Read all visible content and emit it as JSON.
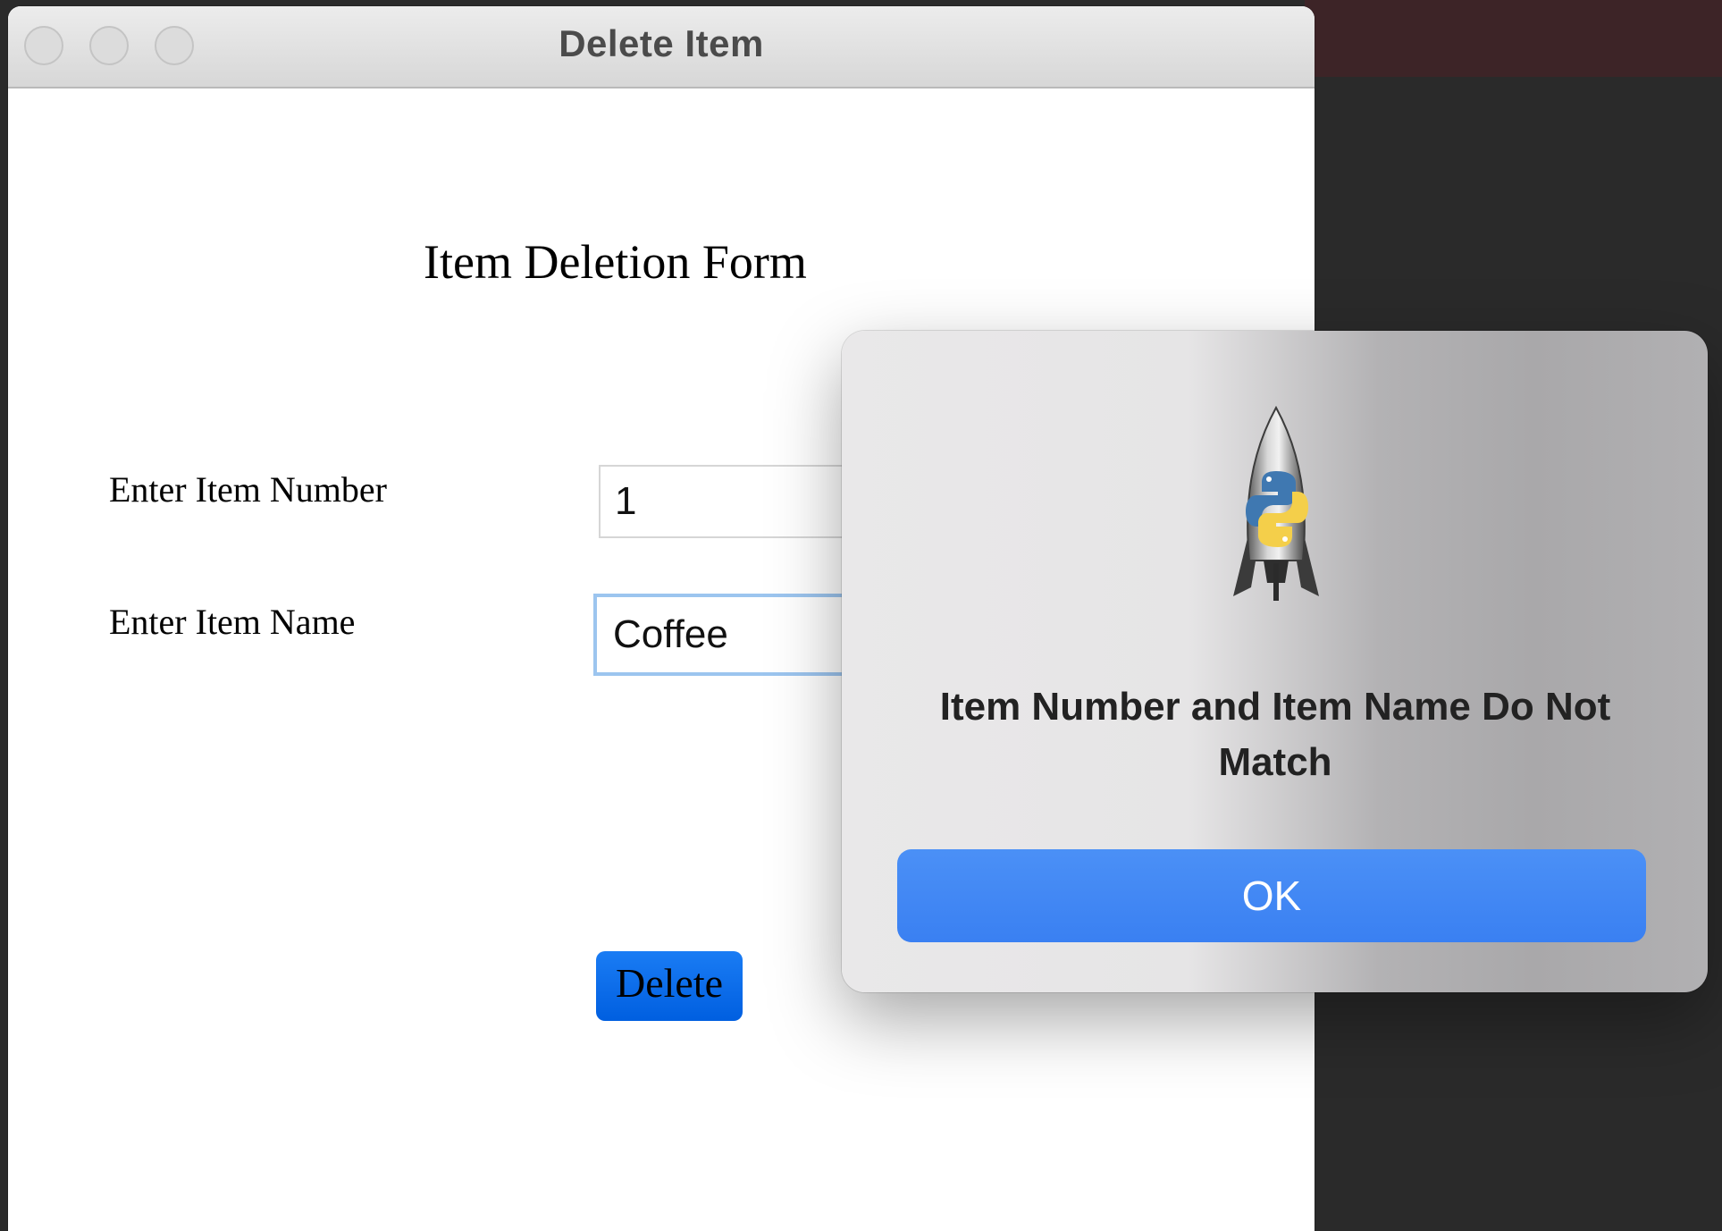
{
  "window": {
    "title": "Delete Item"
  },
  "form": {
    "heading": "Item Deletion Form",
    "item_number_label": "Enter Item Number",
    "item_number_value": "1",
    "item_name_label": "Enter Item Name",
    "item_name_value": "Coffee",
    "delete_label": "Delete"
  },
  "alert": {
    "icon": "python-launcher-rocket-icon",
    "message": "Item Number and Item Name Do Not Match",
    "ok_label": "OK"
  },
  "colors": {
    "delete_button": "#0a6ef0",
    "ok_button": "#3f86f4",
    "focus_ring": "#9cc5ef"
  }
}
